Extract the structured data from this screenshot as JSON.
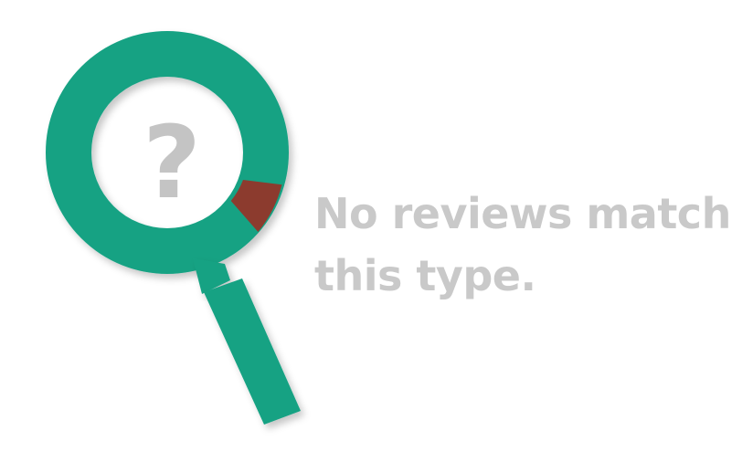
{
  "empty_state": {
    "icon": "magnifying-glass-question-icon",
    "question_mark": "?",
    "message_line_1": "No reviews match",
    "message_line_2": "this type.",
    "colors": {
      "ring": "#17a283",
      "ring_accent": "#8c3b2e",
      "handle": "#17a283",
      "text": "#c9c9c9",
      "question_mark": "#c4c4c4"
    }
  }
}
